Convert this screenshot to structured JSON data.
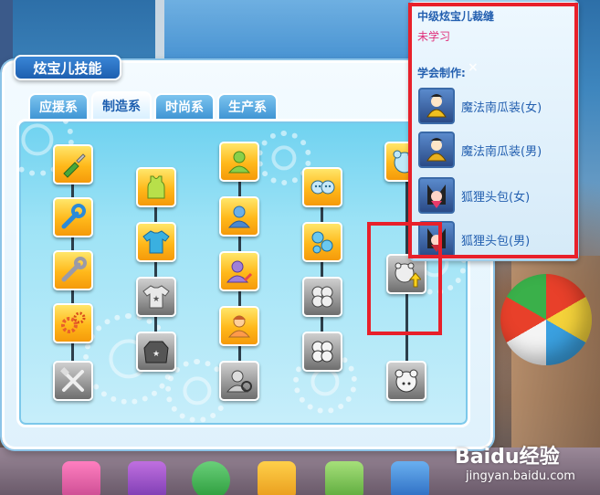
{
  "window": {
    "title": "炫宝儿技能"
  },
  "tabs": [
    {
      "label": "应援系",
      "active": false
    },
    {
      "label": "制造系",
      "active": true
    },
    {
      "label": "时尚系",
      "active": false
    },
    {
      "label": "生产系",
      "active": false
    }
  ],
  "skill_tree": {
    "columns": [
      {
        "category": "tools",
        "icons": [
          "screwdriver-icon",
          "wrench-icon",
          "wrench-2-icon",
          "gears-icon",
          "hammer-wrench-icon"
        ],
        "states": [
          "gold",
          "gold",
          "gold",
          "gold",
          "gray"
        ]
      },
      {
        "category": "clothing",
        "icons": [
          "tank-top-icon",
          "t-shirt-icon",
          "star-shirt-icon",
          "star-sweater-icon"
        ],
        "states": [
          "gold",
          "gold",
          "gray",
          "gray"
        ]
      },
      {
        "category": "figures",
        "icons": [
          "person-icon",
          "person-suit-icon",
          "person-pen-icon",
          "person-hair-icon",
          "person-wrench-icon"
        ],
        "states": [
          "gold",
          "gold",
          "gold",
          "gold",
          "gray"
        ]
      },
      {
        "category": "buttons",
        "icons": [
          "buttons-icon",
          "buttons-blue-icon",
          "buttons-gray-icon",
          "buttons-quad-icon"
        ],
        "states": [
          "gold",
          "gold",
          "gray",
          "gray"
        ]
      },
      {
        "category": "pig-bag",
        "icons": [
          "pig-face-icon",
          "pig-upgrade-icon",
          "pig-button-icon"
        ],
        "states": [
          "gold",
          "gray",
          "gray"
        ]
      }
    ]
  },
  "info_panel": {
    "title": "中级炫宝儿裁缝",
    "status": "未学习",
    "learn_label": "学会制作:",
    "close_glyph": "×",
    "recipes": [
      {
        "label": "魔法南瓜装(女)",
        "icon": "pumpkin-outfit-icon"
      },
      {
        "label": "魔法南瓜装(男)",
        "icon": "pumpkin-outfit-icon"
      },
      {
        "label": "狐狸头包(女)",
        "icon": "fox-hood-icon"
      },
      {
        "label": "狐狸头包(男)",
        "icon": "fox-hood-icon"
      }
    ]
  },
  "watermark": {
    "logo": "Baidu经验",
    "url": "jingyan.baidu.com"
  },
  "colors": {
    "accent": "#1d5fb0",
    "highlight": "#e8202a",
    "status_pink": "#e0307a",
    "skill_gold": "#ffb81a",
    "skill_gray": "#9a9a9a"
  }
}
